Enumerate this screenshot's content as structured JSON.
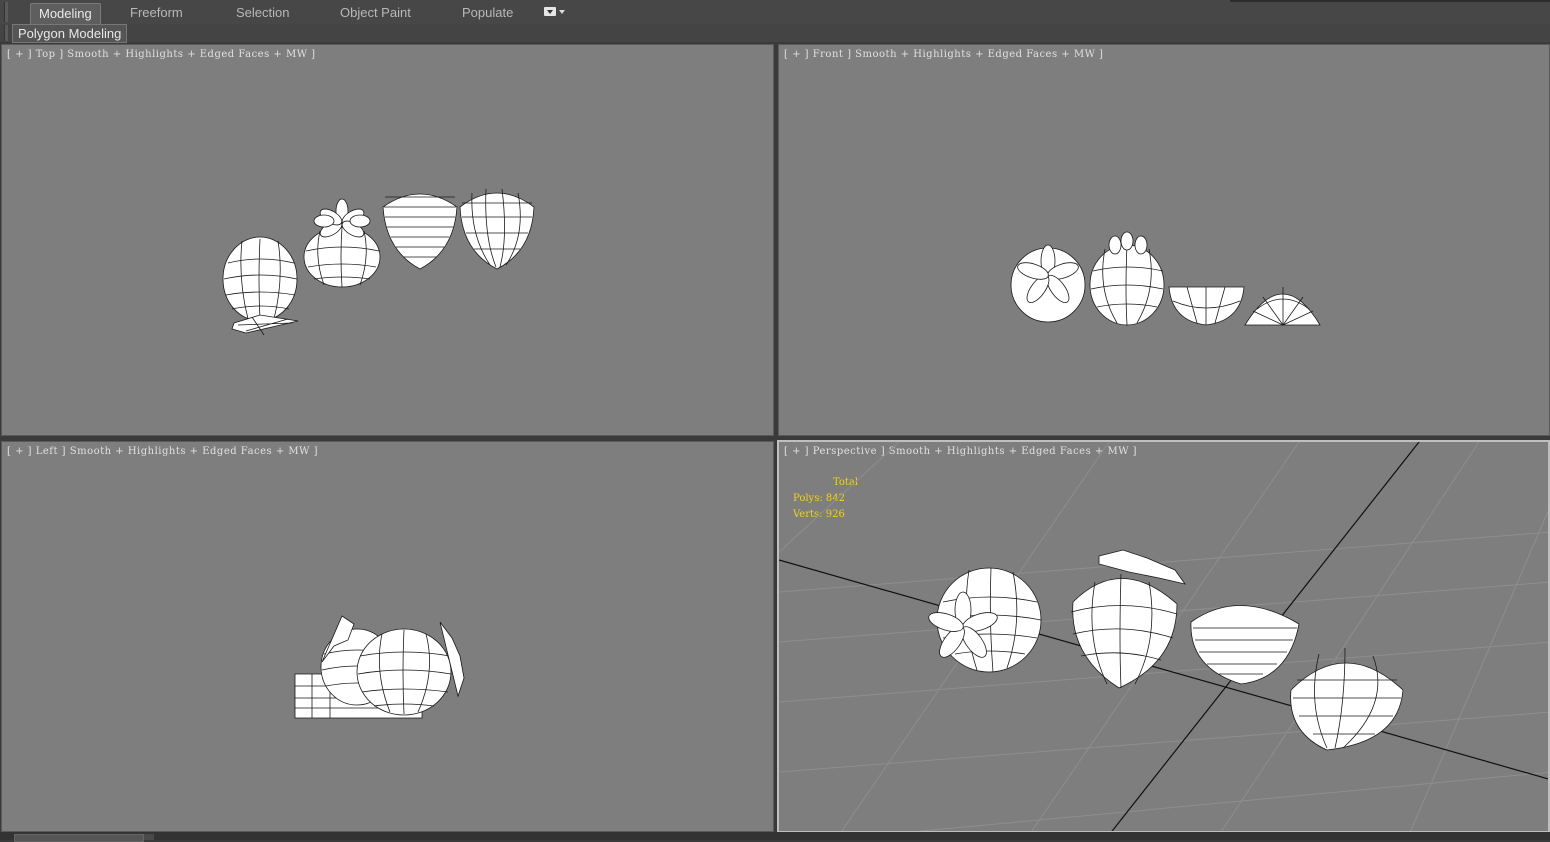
{
  "ribbon": {
    "tabs": [
      {
        "label": "Modeling",
        "active": true
      },
      {
        "label": "Freeform",
        "active": false
      },
      {
        "label": "Selection",
        "active": false
      },
      {
        "label": "Object Paint",
        "active": false
      },
      {
        "label": "Populate",
        "active": false
      }
    ],
    "menu_icon": "dropdown-menu-icon",
    "panel_label": "Polygon Modeling"
  },
  "viewports": {
    "top": {
      "label": "[ + ] Top ] Smooth + Highlights + Edged Faces + MW ]"
    },
    "front": {
      "label": "[ + ] Front ] Smooth + Highlights + Edged Faces + MW ]"
    },
    "left": {
      "label": "[ + ] Left ] Smooth + Highlights + Edged Faces + MW ]"
    },
    "perspective": {
      "label": "[ + ] Perspective ] Smooth + Highlights + Edged Faces + MW ]",
      "stats": {
        "title": "Total",
        "polys_label": "Polys:",
        "polys_value": "842",
        "verts_label": "Verts:",
        "verts_value": "926"
      }
    }
  },
  "colors": {
    "viewport_bg": "#7e7e7e",
    "stats_text": "#f2d21a",
    "active_border": "#bfbfbf",
    "mesh_fill": "#ffffff",
    "mesh_wire": "#1a1a1a"
  }
}
